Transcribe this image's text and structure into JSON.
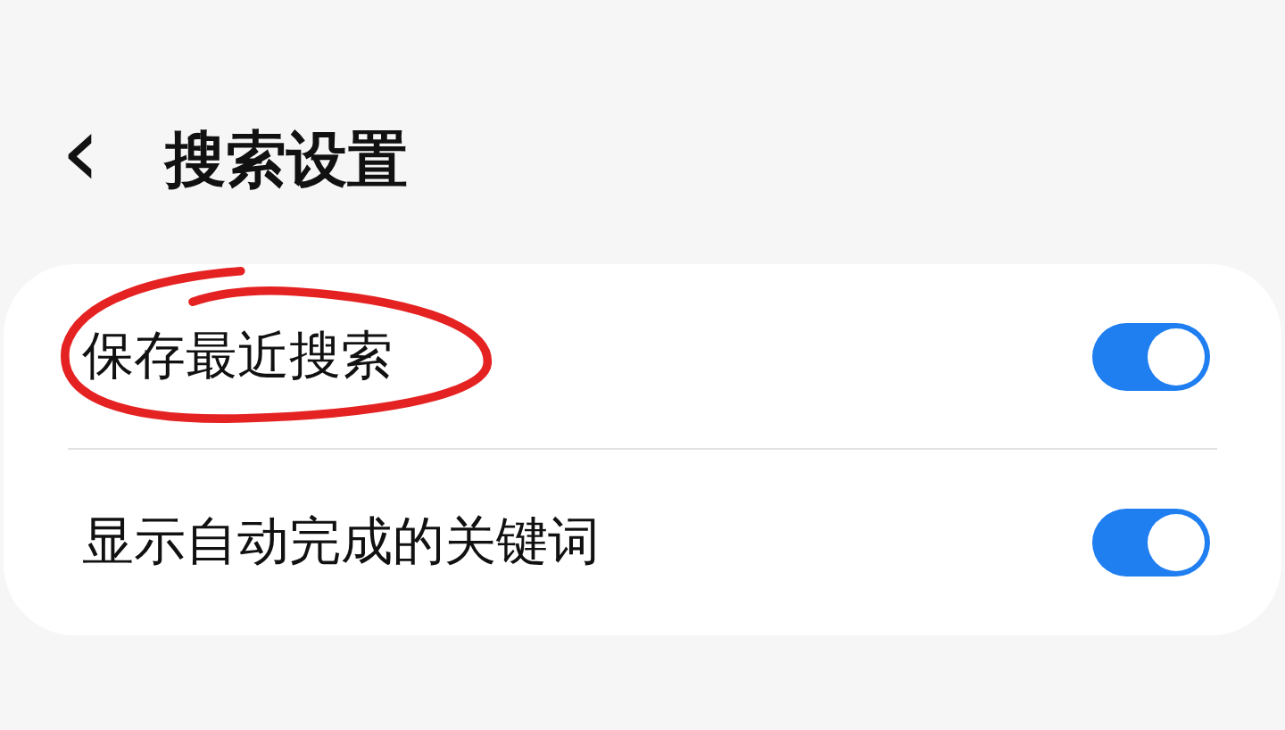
{
  "header": {
    "back": "‹",
    "title": "搜索设置"
  },
  "settings": [
    {
      "label": "保存最近搜索",
      "on": true
    },
    {
      "label": "显示自动完成的关键词",
      "on": true
    }
  ],
  "annotation": {
    "kind": "circle"
  }
}
